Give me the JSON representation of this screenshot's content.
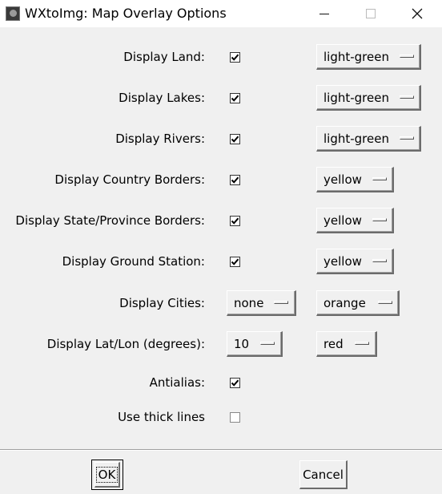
{
  "window": {
    "title": "WXtoImg: Map Overlay Options"
  },
  "rows": [
    {
      "label": "Display Land:",
      "checked": true,
      "color": "light-green"
    },
    {
      "label": "Display Lakes:",
      "checked": true,
      "color": "light-green"
    },
    {
      "label": "Display Rivers:",
      "checked": true,
      "color": "light-green"
    },
    {
      "label": "Display Country Borders:",
      "checked": true,
      "color": "yellow"
    },
    {
      "label": "Display State/Province Borders:",
      "checked": true,
      "color": "yellow"
    },
    {
      "label": "Display Ground Station:",
      "checked": true,
      "color": "yellow"
    },
    {
      "label": "Display Cities:",
      "option": "none",
      "color": "orange"
    },
    {
      "label": "Display Lat/Lon (degrees):",
      "option": "10",
      "color": "red"
    },
    {
      "label": "Antialias:",
      "checked": true
    },
    {
      "label": "Use thick lines",
      "checked": false
    }
  ],
  "buttons": {
    "ok": "OK",
    "cancel": "Cancel"
  },
  "icons": {
    "app": "wxtoimg-app-icon",
    "minimize": "minimize-icon",
    "maximize": "maximize-icon",
    "close": "close-icon",
    "check": "checkmark-icon",
    "menu_indicator": "option-menu-indicator-icon"
  }
}
